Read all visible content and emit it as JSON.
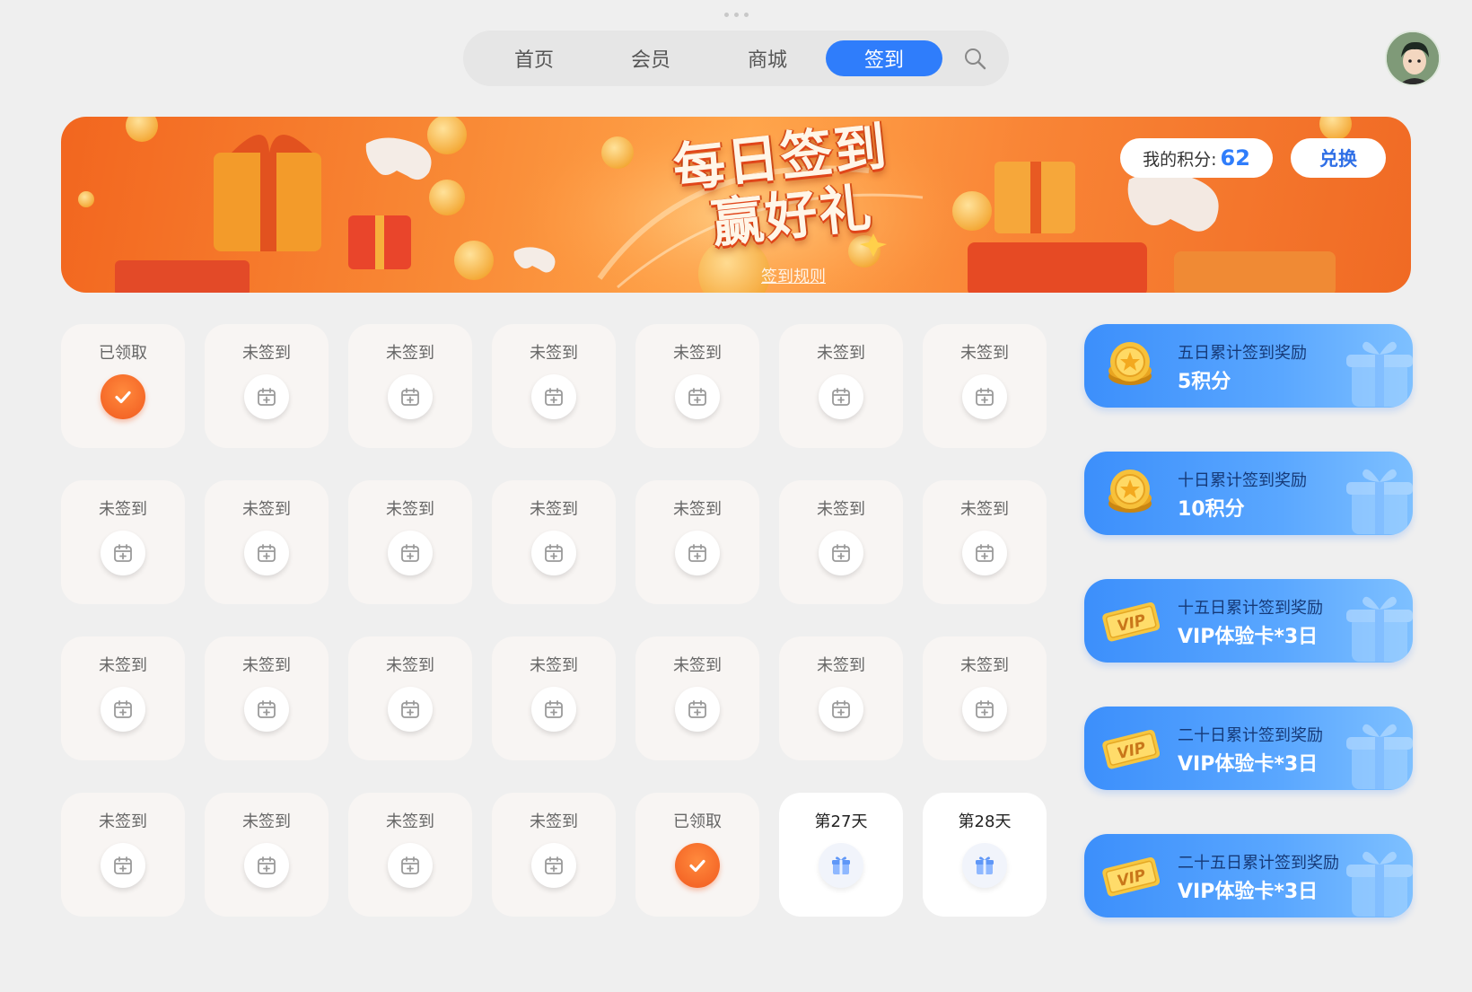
{
  "nav": {
    "tabs": [
      {
        "label": "首页",
        "active": false
      },
      {
        "label": "会员",
        "active": false
      },
      {
        "label": "商城",
        "active": false
      },
      {
        "label": "签到",
        "active": true
      }
    ],
    "search_icon": "search-icon"
  },
  "banner": {
    "title_line1": "每日签到",
    "title_line2": "赢好礼",
    "rules_link": "签到规则",
    "points_label": "我的积分:",
    "points_value": "62",
    "exchange_label": "兑换"
  },
  "days": [
    {
      "label": "已领取",
      "state": "claimed"
    },
    {
      "label": "未签到",
      "state": "unsigned"
    },
    {
      "label": "未签到",
      "state": "unsigned"
    },
    {
      "label": "未签到",
      "state": "unsigned"
    },
    {
      "label": "未签到",
      "state": "unsigned"
    },
    {
      "label": "未签到",
      "state": "unsigned"
    },
    {
      "label": "未签到",
      "state": "unsigned"
    },
    {
      "label": "未签到",
      "state": "unsigned"
    },
    {
      "label": "未签到",
      "state": "unsigned"
    },
    {
      "label": "未签到",
      "state": "unsigned"
    },
    {
      "label": "未签到",
      "state": "unsigned"
    },
    {
      "label": "未签到",
      "state": "unsigned"
    },
    {
      "label": "未签到",
      "state": "unsigned"
    },
    {
      "label": "未签到",
      "state": "unsigned"
    },
    {
      "label": "未签到",
      "state": "unsigned"
    },
    {
      "label": "未签到",
      "state": "unsigned"
    },
    {
      "label": "未签到",
      "state": "unsigned"
    },
    {
      "label": "未签到",
      "state": "unsigned"
    },
    {
      "label": "未签到",
      "state": "unsigned"
    },
    {
      "label": "未签到",
      "state": "unsigned"
    },
    {
      "label": "未签到",
      "state": "unsigned"
    },
    {
      "label": "未签到",
      "state": "unsigned"
    },
    {
      "label": "未签到",
      "state": "unsigned"
    },
    {
      "label": "未签到",
      "state": "unsigned"
    },
    {
      "label": "未签到",
      "state": "unsigned"
    },
    {
      "label": "已领取",
      "state": "claimed"
    },
    {
      "label": "第27天",
      "state": "future"
    },
    {
      "label": "第28天",
      "state": "future"
    }
  ],
  "rewards": [
    {
      "title": "五日累计签到奖励",
      "value": "5积分",
      "icon": "coin-icon"
    },
    {
      "title": "十日累计签到奖励",
      "value": "10积分",
      "icon": "coin-icon"
    },
    {
      "title": "十五日累计签到奖励",
      "value": "VIP体验卡*3日",
      "icon": "vip-ticket-icon"
    },
    {
      "title": "二十日累计签到奖励",
      "value": "VIP体验卡*3日",
      "icon": "vip-ticket-icon"
    },
    {
      "title": "二十五日累计签到奖励",
      "value": "VIP体验卡*3日",
      "icon": "vip-ticket-icon"
    }
  ],
  "colors": {
    "accent": "#2f7dfb",
    "banner_orange": "#f98a36",
    "claimed_orange": "#f15a1f",
    "reward_blue": "#3c8ffb"
  }
}
